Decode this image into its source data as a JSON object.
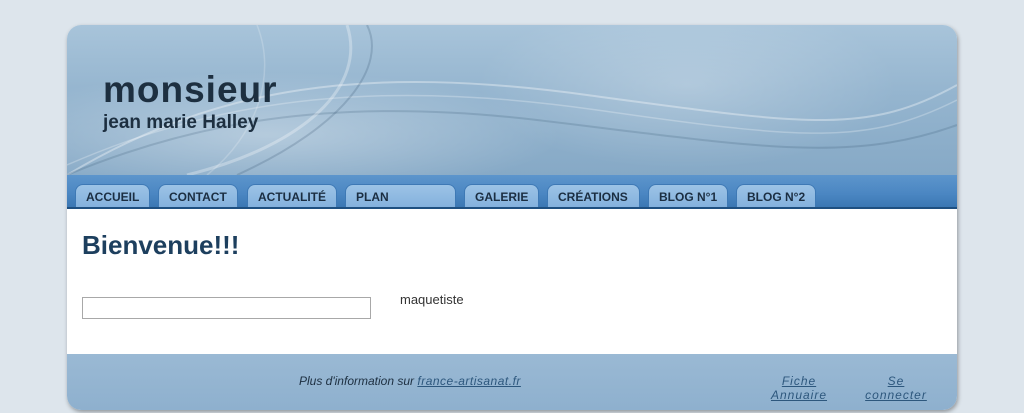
{
  "header": {
    "title": "monsieur",
    "subtitle": "jean marie Halley"
  },
  "nav": {
    "items": [
      {
        "label": "ACCUEIL"
      },
      {
        "label": "CONTACT"
      },
      {
        "label": "ACTUALITÉ"
      },
      {
        "label": "PLAN"
      },
      {
        "label": "GALERIE"
      },
      {
        "label": "CRÉATIONS"
      },
      {
        "label": "BLOG N°1"
      },
      {
        "label": "BLOG N°2"
      }
    ]
  },
  "main": {
    "heading": "Bienvenue!!!",
    "field_value": "",
    "caption": "maquetiste"
  },
  "footer": {
    "info_prefix": "Plus d'information sur",
    "info_link": "france-artisanat.fr",
    "link_annuaire_line1": "Fiche",
    "link_annuaire_line2": "Annuaire",
    "link_connect_line1": "Se",
    "link_connect_line2": "connecter"
  },
  "colors": {
    "nav_bar": "#4a86c2",
    "tab": "#9cc3e6",
    "heading": "#1d3f5e",
    "background": "#dde5ec"
  }
}
